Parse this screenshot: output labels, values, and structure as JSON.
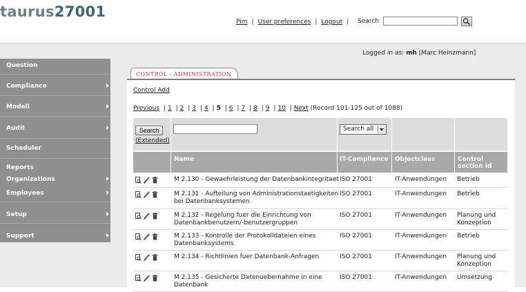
{
  "header": {
    "logo_prefix": "taurus",
    "logo_number": "27001",
    "nav": [
      "Pim",
      "User preferences",
      "Logout"
    ],
    "search_label": "Search",
    "search_value": ""
  },
  "logged": {
    "prefix": "Logged in as:",
    "user": "mh",
    "full_name": "[Marc Heinzmann]"
  },
  "sidebar": [
    {
      "label": "Question",
      "arrow": false
    },
    {
      "label": "Compliance",
      "arrow": true
    },
    {
      "label": "Modell",
      "arrow": true
    },
    {
      "label": "Audit",
      "arrow": true
    },
    {
      "label": "Scheduler",
      "arrow": false
    },
    {
      "label": "Reports",
      "arrow": false
    },
    {
      "label": "Organizations",
      "arrow": true
    },
    {
      "label": "Employees",
      "arrow": true
    },
    {
      "label": "Setup",
      "arrow": true
    },
    {
      "label": "Support",
      "arrow": true
    }
  ],
  "tab": {
    "label": "CONTROL - ADMINISTRATION"
  },
  "control_add": "Control Add",
  "pager": {
    "previous": "Previous",
    "pages": [
      "1",
      "2",
      "3",
      "4",
      "5",
      "6",
      "7",
      "8",
      "9",
      "10"
    ],
    "current": "5",
    "next": "Next",
    "record_info": "(Record 101-125 out of 1088)"
  },
  "filter": {
    "search_button": "Search",
    "extended": "(Extended)",
    "name_value": "",
    "select_value": "Search all"
  },
  "columns": {
    "name": "Name",
    "it_compliance": "IT-Compliance",
    "objectclass": "Objectclass",
    "control_section_l1": "Control",
    "control_section_l2": "section id"
  },
  "rows": [
    {
      "name_l1": "M 2.130 - Gewaehrleistung der Datenbankintegritaet",
      "name_l2": "",
      "compliance": "ISO 27001",
      "objectclass": "IT-Anwendungen",
      "section_l1": "Betrieb",
      "section_l2": ""
    },
    {
      "name_l1": "M 2.131 - Aufteilung von Administrationstaetigkeiten",
      "name_l2": "bei Datenbanksystemen",
      "compliance": "ISO 27001",
      "objectclass": "IT-Anwendungen",
      "section_l1": "Betrieb",
      "section_l2": ""
    },
    {
      "name_l1": "M 2.132 - Regelung fuer die Einrichtung von",
      "name_l2": "Datenbankbenutzern/-benutzergruppen",
      "compliance": "ISO 27001",
      "objectclass": "IT-Anwendungen",
      "section_l1": "Planung und",
      "section_l2": "Konzeption"
    },
    {
      "name_l1": "M 2.133 - Kontrolle der Protokolldateien eines",
      "name_l2": "Datenbanksystems",
      "compliance": "ISO 27001",
      "objectclass": "IT-Anwendungen",
      "section_l1": "Betrieb",
      "section_l2": ""
    },
    {
      "name_l1": "M 2.134 - Richtlinien fuer Datenbank-Anfragen",
      "name_l2": "",
      "compliance": "ISO 27001",
      "objectclass": "IT-Anwendungen",
      "section_l1": "Planung und",
      "section_l2": "Konzeption"
    },
    {
      "name_l1": "M 2.135 - Gesicherte Datenuebernahme in eine",
      "name_l2": "Datenbank",
      "compliance": "ISO 27001",
      "objectclass": "IT-Anwendungen",
      "section_l1": "Umsetzung",
      "section_l2": ""
    }
  ],
  "icons": [
    "view-icon",
    "edit-pencil-icon",
    "delete-trash-icon"
  ],
  "colors": {
    "sidebar": "#8f8f8f",
    "table_header": "#a9a9a9",
    "tab_label": "#c23b3b",
    "logo_grey": "#6e7f86",
    "logo_blue": "#3f6675"
  }
}
